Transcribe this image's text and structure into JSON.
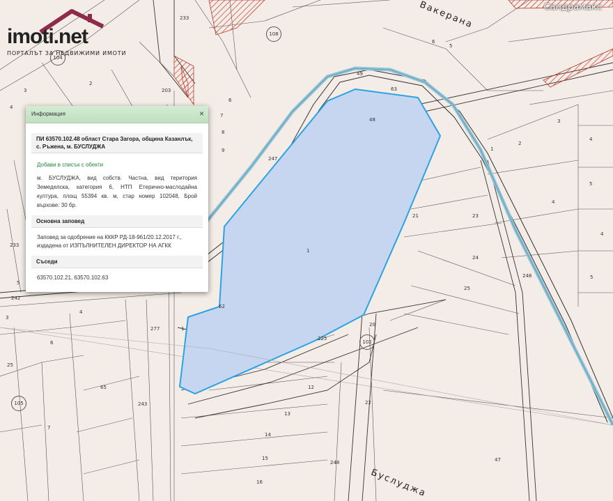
{
  "logo": {
    "name": "imoti",
    "tld": ".net",
    "tagline": "ПОРТАЛЪТ ЗА НЕДВИЖИМИ ИМОТИ"
  },
  "watermark": "Сандрамакс",
  "colors": {
    "parcel_fill": "#c6d6f0",
    "parcel_stroke": "#2aa3e3",
    "road": "#333333",
    "channel": "#8fc4d9",
    "hatch": "#c0392b",
    "background": "#f4ece6"
  },
  "map": {
    "road_names": [
      "Вакерана",
      "Буслуджа"
    ],
    "circled_labels": [
      "108",
      "104",
      "105",
      "102"
    ],
    "parcel_labels": [
      "233",
      "203",
      "3",
      "2",
      "4",
      "5",
      "6",
      "7",
      "8",
      "9",
      "1",
      "4",
      "247",
      "49",
      "63",
      "48",
      "21",
      "23",
      "24",
      "25",
      "248",
      "3",
      "2",
      "1",
      "4",
      "5",
      "233",
      "242",
      "4",
      "3",
      "6",
      "7",
      "65",
      "25",
      "277",
      "1",
      "243",
      "5",
      "62",
      "20",
      "225",
      "12",
      "13",
      "14",
      "15",
      "16",
      "22",
      "248",
      "47",
      "4",
      "5",
      "6"
    ]
  },
  "info_panel": {
    "header": "Информация",
    "close_icon": "close-icon",
    "close_glyph": "×",
    "title": "ПИ 63570.102.48 област Стара Загора, община Казанлък, с. Ръжена, м. БУСЛУДЖА",
    "add_link": "Добави в списък с обекти",
    "description": "м. БУСЛУДЖА, вид собств. Частна, вид територия Земеделска, категория 6, НТП Етерично-маслодайна култура, площ 55394 кв. м, стар номер 102048, Брой върхове: 30 бр.",
    "order_heading": "Основна заповед",
    "order_text": "Заповед за одобрение на КККР РД-18-961/20.12.2017 г., издадена от ИЗПЪЛНИТЕЛЕН ДИРЕКТОР НА АГКК",
    "neighbors_heading": "Съседи",
    "neighbors": "63570.102.21, 63570.102.63"
  }
}
